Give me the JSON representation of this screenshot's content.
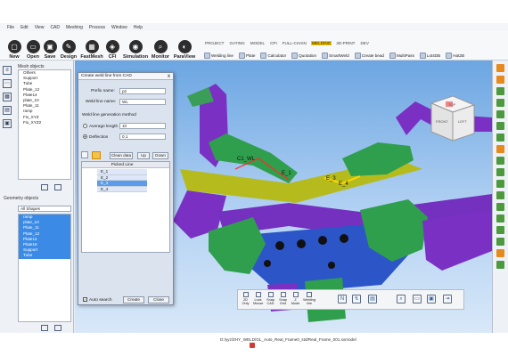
{
  "menu": [
    "File",
    "Edit",
    "View",
    "CAD",
    "Meshing",
    "Process",
    "Window",
    "Help"
  ],
  "toolbar": [
    {
      "label": "New",
      "icon": "new-file-icon"
    },
    {
      "label": "Open",
      "icon": "open-folder-icon"
    },
    {
      "label": "Save",
      "icon": "save-icon"
    },
    {
      "label": "Design",
      "icon": "design-icon"
    },
    {
      "label": "FastMesh",
      "icon": "fastmesh-icon"
    },
    {
      "label": "CFI",
      "icon": "cfi-icon"
    },
    {
      "label": "Simulation",
      "icon": "simulation-icon"
    },
    {
      "label": "Monitor",
      "icon": "monitor-icon"
    },
    {
      "label": "ParaView",
      "icon": "paraview-icon"
    }
  ],
  "mode_tabs": [
    "PROJECT",
    "GATING",
    "MODEL",
    "CPI",
    "FULL-CHAIN",
    "WELDING",
    "3D-PRINT",
    "DEV"
  ],
  "active_mode": "WELDING",
  "ribbon": [
    "Welding line",
    "Plate",
    "Calculator",
    "Quotation",
    "SmartWeld",
    "Create bead",
    "MultiPass",
    "Lot4DB",
    "Hat2B"
  ],
  "left_panel": {
    "mesh_title": "Mesh objects",
    "mesh_items": [
      "Others",
      "Support",
      "Tube",
      "Plate_12",
      "Plate14",
      "plate_10",
      "Plate_11",
      "ramp",
      "Fix_XYZ",
      "Fix_XYZ2"
    ],
    "geometry_title": "Geometry objects",
    "filter_value": "All Shapes",
    "geometry_items": [
      "ramp",
      "plate_10",
      "Plate_11",
      "Plate_12",
      "Plate14",
      "Plate16",
      "Support",
      "Tube"
    ]
  },
  "dialog": {
    "title": "Create weld line from CAD",
    "close": "x",
    "prefix_label": "Prefix name:",
    "prefix_value": "p2",
    "weld_label": "Weld line name:",
    "weld_value": "WL",
    "method_label": "Weld line generation method",
    "avg_label": "Average length",
    "avg_value": "10",
    "defl_label": "Deflection",
    "defl_value": "0.1",
    "clear_btn": "Clean data",
    "up_btn": "Up",
    "down_btn": "Down",
    "grid_header": "Picked Line",
    "grid_rows": [
      "E_1",
      "E_2",
      "E_3",
      "E_4"
    ],
    "selected_row": "E_3",
    "auto_search": "Auto search",
    "check_mark": "✓",
    "create_btn": "Create",
    "close_btn": "Close"
  },
  "viewcube": {
    "front": "FRONT",
    "left": "LEFT",
    "top": "TOP"
  },
  "annotations": {
    "weld_label": "C1_WL",
    "e1": "E_1",
    "e2": "E_3",
    "e3": "E_4"
  },
  "view_toolbar": [
    "2D Only",
    "Lock Mouse",
    "Snap CAD",
    "Snap Grid",
    "Z Mode",
    "Welding line"
  ],
  "status_path": "D:/yyz/ZHY_WELD/GL_Auto_Real_Frame0_std/Real_Frame_001.xxmodel",
  "colors": {
    "accent": "#f6c700",
    "selection": "#3b8be6",
    "part_green": "#2e9a4c",
    "part_purple": "#6b2fb8",
    "part_yellow": "#b9c11c",
    "part_blue": "#2d54c9"
  }
}
